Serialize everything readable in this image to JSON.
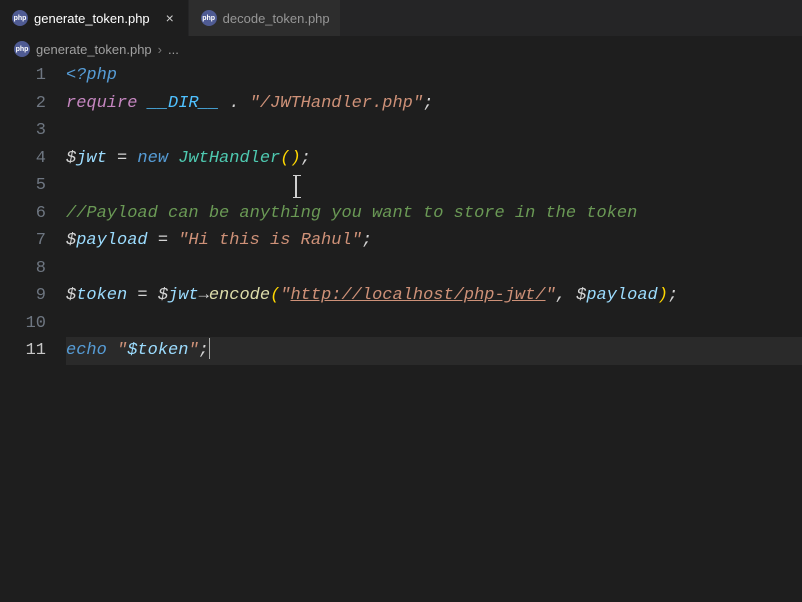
{
  "tabs": [
    {
      "icon": "php",
      "label": "generate_token.php",
      "active": true,
      "close": "×"
    },
    {
      "icon": "php",
      "label": "decode_token.php",
      "active": false
    }
  ],
  "breadcrumb": {
    "icon": "php",
    "file": "generate_token.php",
    "sep": "›",
    "more": "..."
  },
  "code": {
    "l1": {
      "open": "<?php"
    },
    "l2": {
      "kw": "require",
      "const": "__DIR__",
      "dot": ".",
      "str": "\"/JWTHandler.php\"",
      "semi": ";"
    },
    "l4": {
      "d": "$",
      "var": "jwt",
      "eq": "=",
      "new": "new",
      "class": "JwtHandler",
      "po": "(",
      "pc": ")",
      "semi": ";"
    },
    "l6": {
      "cmt": "//Payload can be anything you want to store in the token"
    },
    "l7": {
      "d": "$",
      "var": "payload",
      "eq": "=",
      "str": "\"Hi this is Rahul\"",
      "semi": ";"
    },
    "l9": {
      "d1": "$",
      "var1": "token",
      "eq": "=",
      "d2": "$",
      "var2": "jwt",
      "arrow": "→",
      "func": "encode",
      "po": "(",
      "q1": "\"",
      "url": "http://localhost/php-jwt/",
      "q2": "\"",
      "comma": ",",
      "d3": "$",
      "var3": "payload",
      "pc": ")",
      "semi": ";"
    },
    "l11": {
      "echo": "echo",
      "q1": "\"",
      "strd": "$",
      "strvar": "token",
      "q2": "\"",
      "semi": ";"
    }
  },
  "lineNumbers": [
    "1",
    "2",
    "3",
    "4",
    "5",
    "6",
    "7",
    "8",
    "9",
    "10",
    "11"
  ],
  "phpIconText": "php"
}
